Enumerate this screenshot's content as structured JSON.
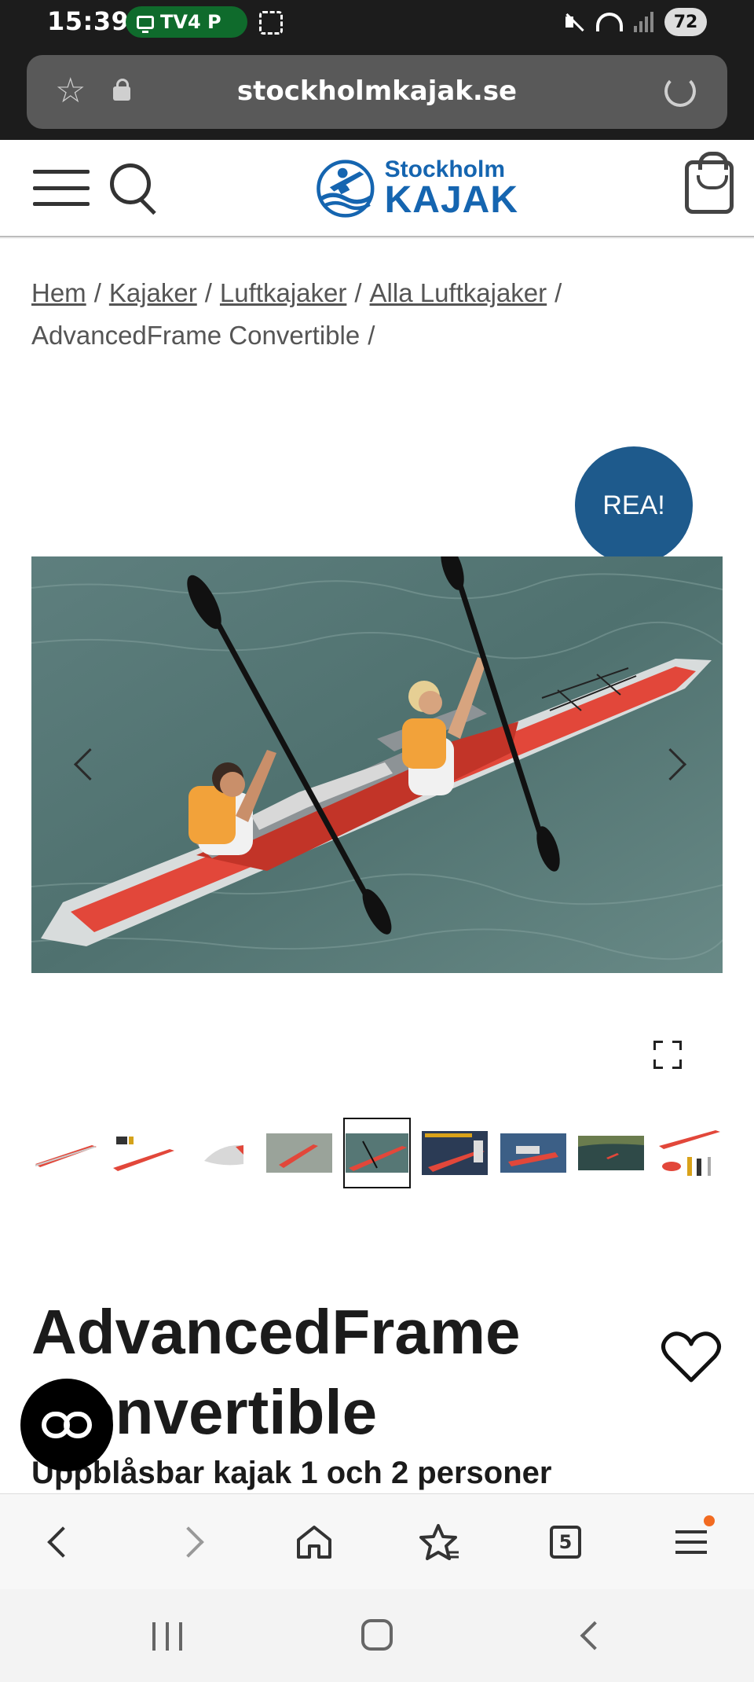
{
  "status_bar": {
    "time": "15:39",
    "pill_label": "TV4 P",
    "battery": "72",
    "icons": [
      "screen-record-icon",
      "mute-icon",
      "wifi-icon",
      "signal-icon"
    ]
  },
  "browser": {
    "url": "stockholmkajak.se",
    "icons": [
      "bookmark-star-icon",
      "lock-icon",
      "reload-icon"
    ]
  },
  "site_header": {
    "logo_line1": "Stockholm",
    "logo_line2": "KAJAK",
    "brand_color": "#1565b0",
    "icons": [
      "menu-icon",
      "search-icon",
      "cart-icon"
    ]
  },
  "breadcrumb": {
    "items": [
      "Hem",
      "Kajaker",
      "Luftkajaker",
      "Alla Luftkajaker"
    ],
    "current": "AdvancedFrame Convertible",
    "separator": "/"
  },
  "product": {
    "sale_badge": "REA!",
    "sale_badge_color": "#1e5a8c",
    "title": "AdvancedFrame Convertible",
    "subtitle": "Uppblåsbar kajak 1 och 2 personer",
    "thumbnail_count": 9,
    "active_thumbnail": 5
  },
  "bottom_toolbar": {
    "tab_count": "5",
    "icons": [
      "back-icon",
      "forward-icon",
      "home-icon",
      "bookmarks-icon",
      "tabs-icon",
      "menu-icon"
    ],
    "notification_color": "#f26b21"
  }
}
